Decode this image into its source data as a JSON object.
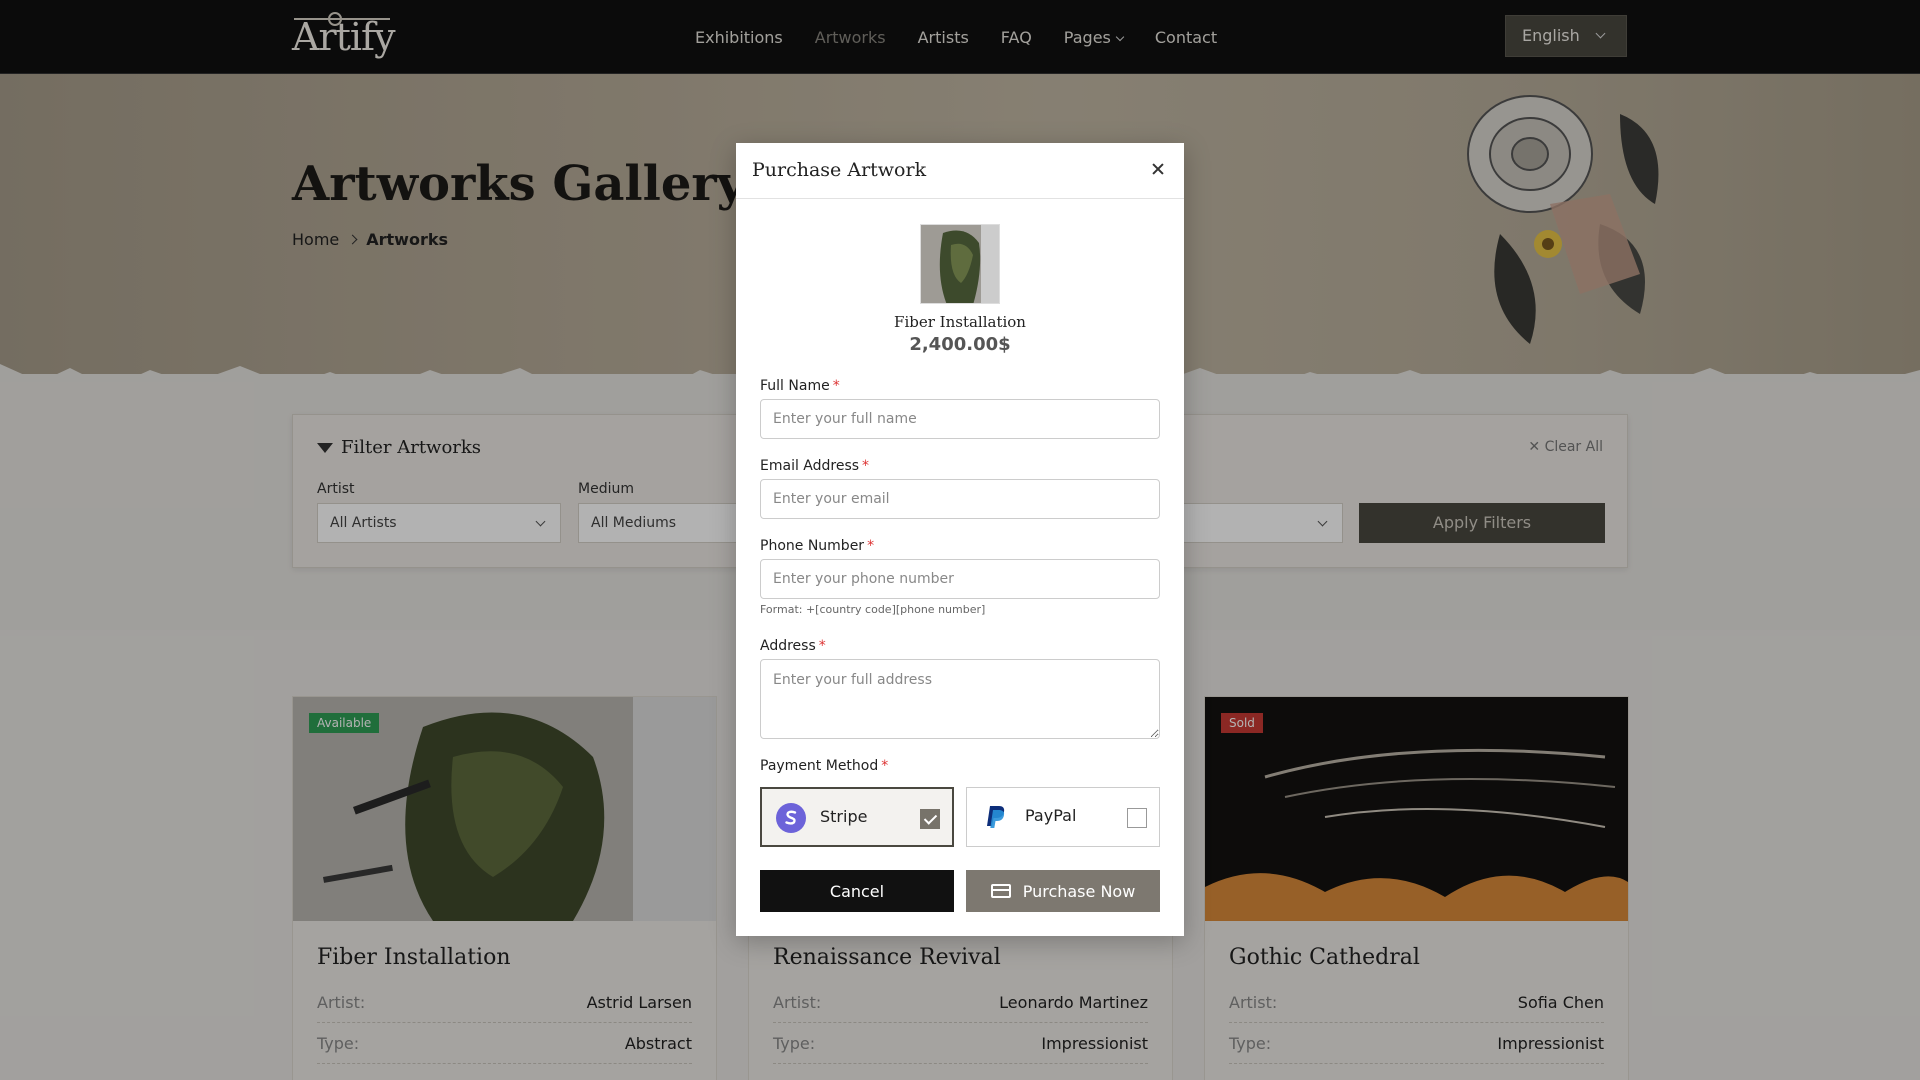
{
  "header": {
    "logo_text": "Artify",
    "nav": [
      {
        "label": "Exhibitions"
      },
      {
        "label": "Artworks"
      },
      {
        "label": "Artists"
      },
      {
        "label": "FAQ"
      },
      {
        "label": "Pages"
      },
      {
        "label": "Contact"
      }
    ],
    "language": "English"
  },
  "hero": {
    "title": "Artworks Gallery",
    "breadcrumb": {
      "home": "Home",
      "current": "Artworks"
    }
  },
  "filter": {
    "title": "Filter Artworks",
    "clear_all": "Clear All",
    "artist_label": "Artist",
    "artist_value": "All Artists",
    "medium_label": "Medium",
    "medium_value": "All Mediums",
    "apply_label": "Apply Filters"
  },
  "cards": [
    {
      "badge": "Available",
      "title": "Fiber Installation",
      "artist_label": "Artist:",
      "artist": "Astrid Larsen",
      "type_label": "Type:",
      "type": "Abstract"
    },
    {
      "badge": "",
      "title": "Renaissance Revival",
      "artist_label": "Artist:",
      "artist": "Leonardo Martinez",
      "type_label": "Type:",
      "type": "Impressionist"
    },
    {
      "badge": "Sold",
      "title": "Gothic Cathedral",
      "artist_label": "Artist:",
      "artist": "Sofia Chen",
      "type_label": "Type:",
      "type": "Impressionist"
    }
  ],
  "modal": {
    "title": "Purchase Artwork",
    "artwork_name": "Fiber Installation",
    "artwork_price": "2,400.00$",
    "full_name_label": "Full Name",
    "full_name_placeholder": "Enter your full name",
    "email_label": "Email Address",
    "email_placeholder": "Enter your email",
    "phone_label": "Phone Number",
    "phone_placeholder": "Enter your phone number",
    "phone_hint": "Format: +[country code][phone number]",
    "address_label": "Address",
    "address_placeholder": "Enter your full address",
    "payment_label": "Payment Method",
    "required_mark": "*",
    "payment_options": [
      {
        "label": "Stripe",
        "selected": true
      },
      {
        "label": "PayPal",
        "selected": false
      }
    ],
    "cancel_label": "Cancel",
    "purchase_label": "Purchase Now"
  },
  "colors": {
    "accent": "#4a4840",
    "available": "#2f9e55",
    "sold": "#c83a34"
  }
}
